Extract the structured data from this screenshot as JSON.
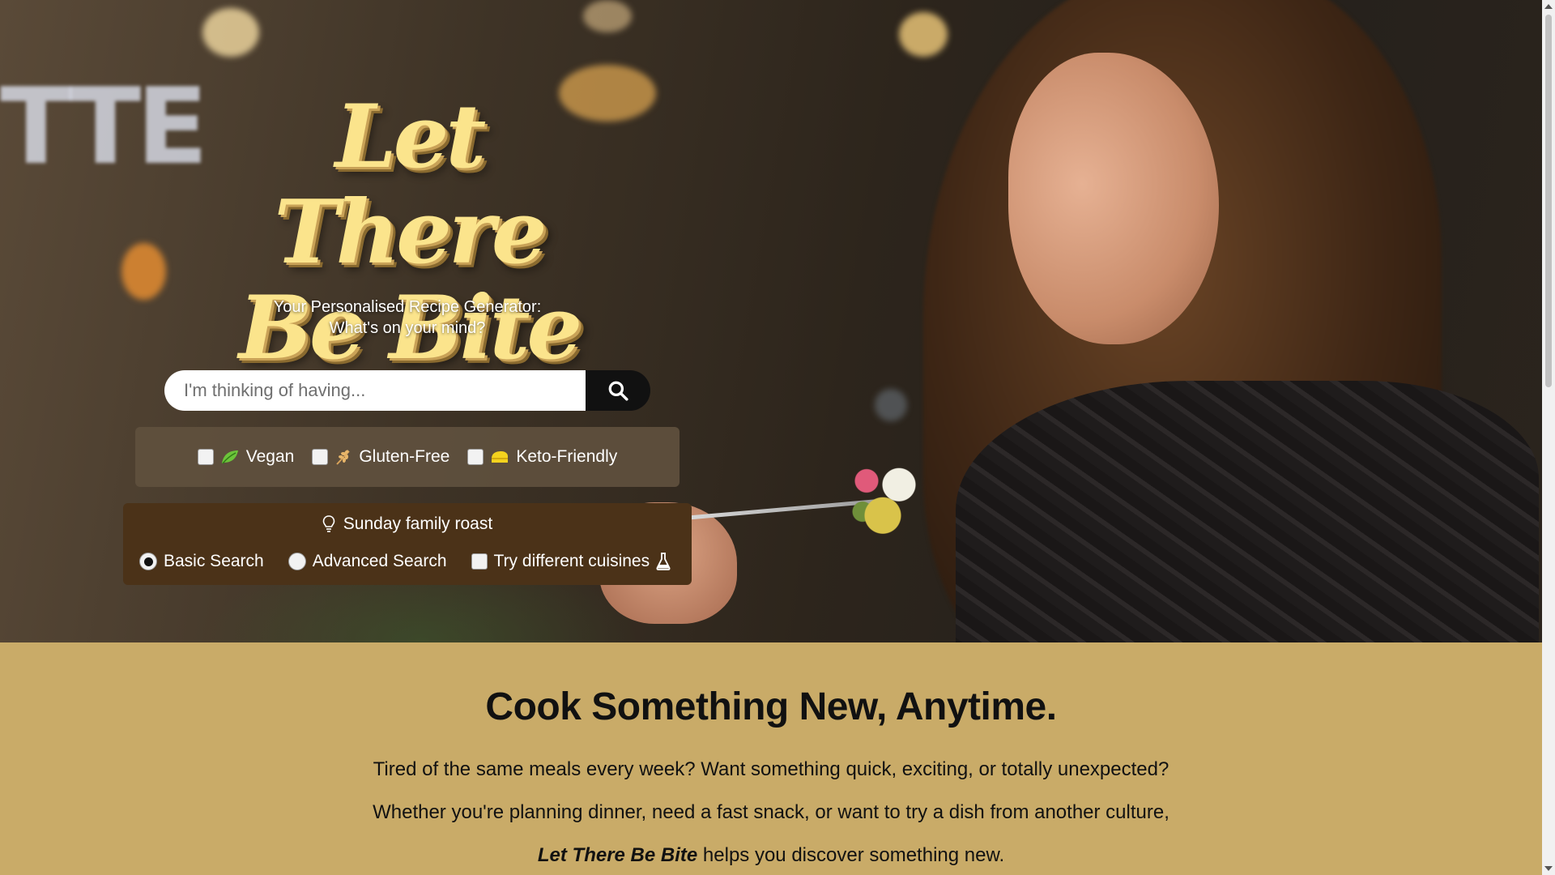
{
  "brand": {
    "logo_line1": "Let There",
    "logo_line2": "Be Bite",
    "tagline_line1": "Your Personalised Recipe Generator:",
    "tagline_line2": "What's on your mind?",
    "logo_color": "#fbe48c"
  },
  "search": {
    "placeholder": "I'm thinking of having...",
    "value": "",
    "button_icon": "search-icon"
  },
  "filters": [
    {
      "label": "Vegan",
      "icon": "leaf-icon",
      "checked": false
    },
    {
      "label": "Gluten-Free",
      "icon": "wheat-icon",
      "checked": false
    },
    {
      "label": "Keto-Friendly",
      "icon": "cheese-icon",
      "checked": false
    }
  ],
  "mode": {
    "suggestion_icon": "lightbulb-icon",
    "suggestion": "Sunday family roast",
    "options": [
      {
        "label": "Basic Search",
        "selected": true
      },
      {
        "label": "Advanced Search",
        "selected": false
      }
    ],
    "cuisines_label": "Try different cuisines",
    "cuisines_icon": "flask-icon",
    "cuisines_checked": false
  },
  "content": {
    "heading": "Cook Something New, Anytime.",
    "para1": "Tired of the same meals every week? Want something quick, exciting, or totally unexpected?",
    "para2": "Whether you're planning dinner, need a fast snack, or want to try a dish from another culture,",
    "para3_bold": "Let There Be Bite",
    "para3_rest": " helps you discover something new.",
    "background": "#c9ab68"
  }
}
